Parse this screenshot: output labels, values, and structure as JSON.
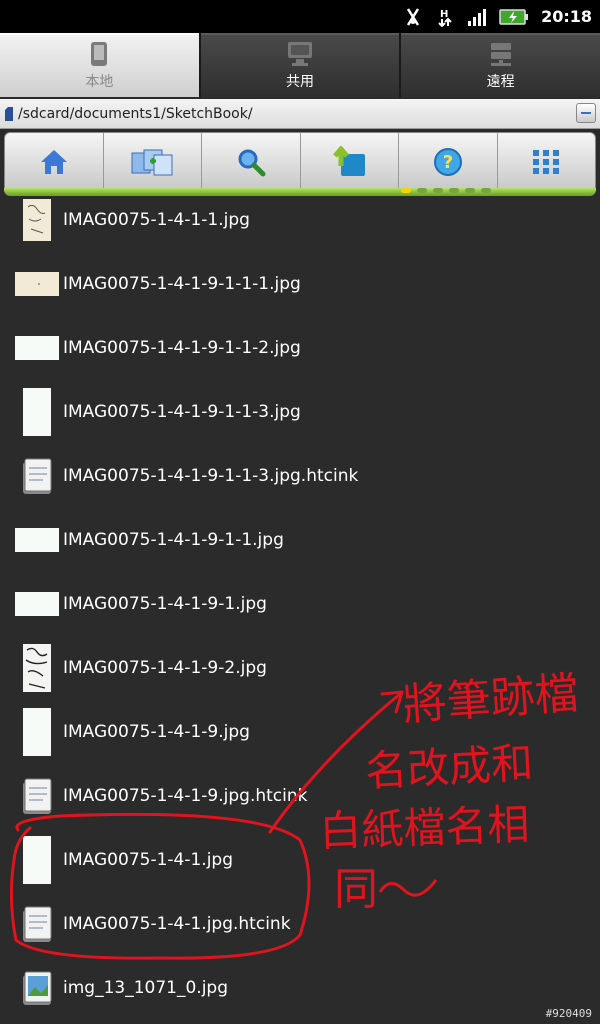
{
  "status_bar": {
    "time": "20:18",
    "icons": [
      "usb-debug-icon",
      "data-transfer-icon",
      "signal-icon",
      "battery-icon"
    ]
  },
  "tabs": [
    {
      "label": "本地",
      "icon": "tablet-icon",
      "active": true
    },
    {
      "label": "共用",
      "icon": "computer-icon",
      "active": false
    },
    {
      "label": "遠程",
      "icon": "server-icon",
      "active": false
    }
  ],
  "path_bar": {
    "path": "/sdcard/documents1/SketchBook/"
  },
  "toolbar": {
    "buttons": [
      "home-icon",
      "multi-select-icon",
      "search-icon",
      "up-folder-icon",
      "help-icon",
      "grid-view-icon"
    ]
  },
  "files": [
    {
      "name": "IMAG0075-1-4-1-1.jpg",
      "thumb": "sketch"
    },
    {
      "name": "IMAG0075-1-4-1-9-1-1-1.jpg",
      "thumb": "wide-beige"
    },
    {
      "name": "IMAG0075-1-4-1-9-1-1-2.jpg",
      "thumb": "wide"
    },
    {
      "name": "IMAG0075-1-4-1-9-1-1-3.jpg",
      "thumb": "tall"
    },
    {
      "name": "IMAG0075-1-4-1-9-1-1-3.jpg.htcink",
      "thumb": "note"
    },
    {
      "name": "IMAG0075-1-4-1-9-1-1.jpg",
      "thumb": "wide"
    },
    {
      "name": "IMAG0075-1-4-1-9-1.jpg",
      "thumb": "wide"
    },
    {
      "name": "IMAG0075-1-4-1-9-2.jpg",
      "thumb": "sketch"
    },
    {
      "name": "IMAG0075-1-4-1-9.jpg",
      "thumb": "tall"
    },
    {
      "name": "IMAG0075-1-4-1-9.jpg.htcink",
      "thumb": "note"
    },
    {
      "name": "IMAG0075-1-4-1.jpg",
      "thumb": "tall"
    },
    {
      "name": "IMAG0075-1-4-1.jpg.htcink",
      "thumb": "note"
    },
    {
      "name": "img_13_1071_0.jpg",
      "thumb": "picture"
    }
  ],
  "annotation": {
    "text_lines": [
      "將筆跡檔",
      "名改成和",
      "白紙檔名相",
      "同"
    ],
    "color": "#e0141e"
  },
  "watermark": "#920409"
}
